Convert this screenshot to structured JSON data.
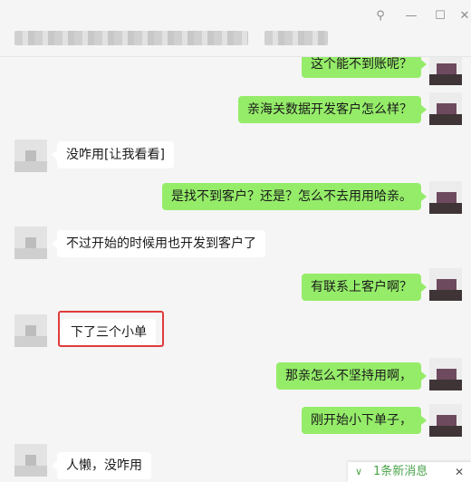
{
  "window_controls": {
    "pin": "⚲",
    "minimize": "—",
    "maximize": "☐",
    "close": "✕"
  },
  "chat": {
    "messages": [
      {
        "side": "me",
        "text": "这个能不到账呢？"
      },
      {
        "side": "me",
        "text": "亲海关数据开发客户怎么样？"
      },
      {
        "side": "them",
        "text": "没咋用[让我看看]"
      },
      {
        "side": "me",
        "text": "是找不到客户？还是？怎么不去用用哈亲。"
      },
      {
        "side": "them",
        "text": "不过开始的时候用也开发到客户了"
      },
      {
        "side": "me",
        "text": "有联系上客户啊？"
      },
      {
        "side": "them",
        "text": "下了三个小单",
        "highlighted": true
      },
      {
        "side": "me",
        "text": "那亲怎么不坚持用啊，"
      },
      {
        "side": "me",
        "text": "刚开始小下单子，"
      },
      {
        "side": "them",
        "text": "人懒，没咋用"
      }
    ]
  },
  "new_message_bar": {
    "label": "1条新消息",
    "chevron": "∨",
    "close": "✕"
  },
  "colors": {
    "my_bubble": "#95ec69",
    "their_bubble": "#ffffff",
    "highlight": "#e03c3c",
    "new_msg_text": "#4aa44a"
  }
}
